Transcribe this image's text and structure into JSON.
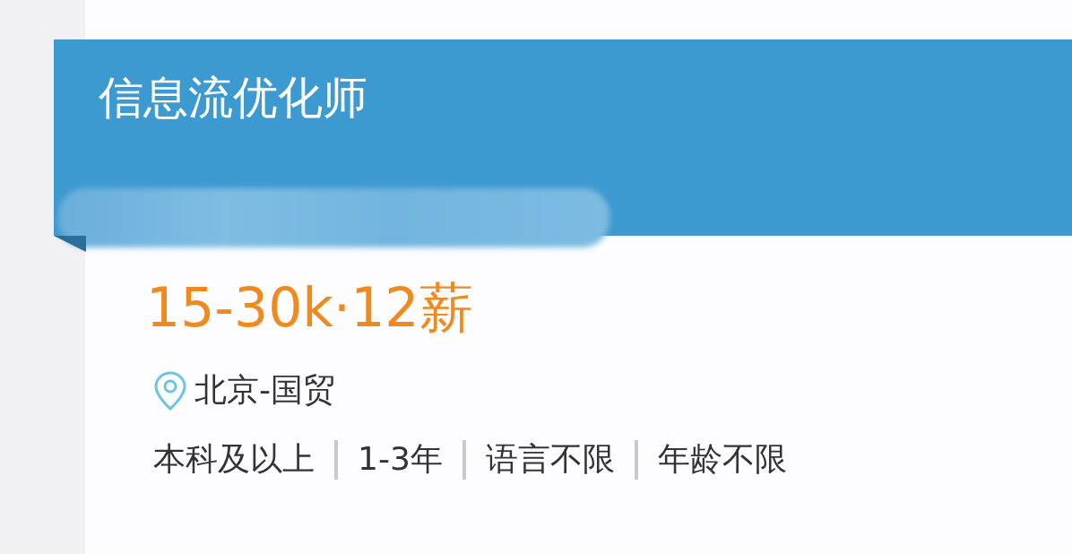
{
  "job": {
    "title": "信息流优化师",
    "salary": "15-30k·12薪",
    "location": "北京-国贸",
    "requirements": [
      "本科及以上",
      "1-3年",
      "语言不限",
      "年龄不限"
    ]
  }
}
